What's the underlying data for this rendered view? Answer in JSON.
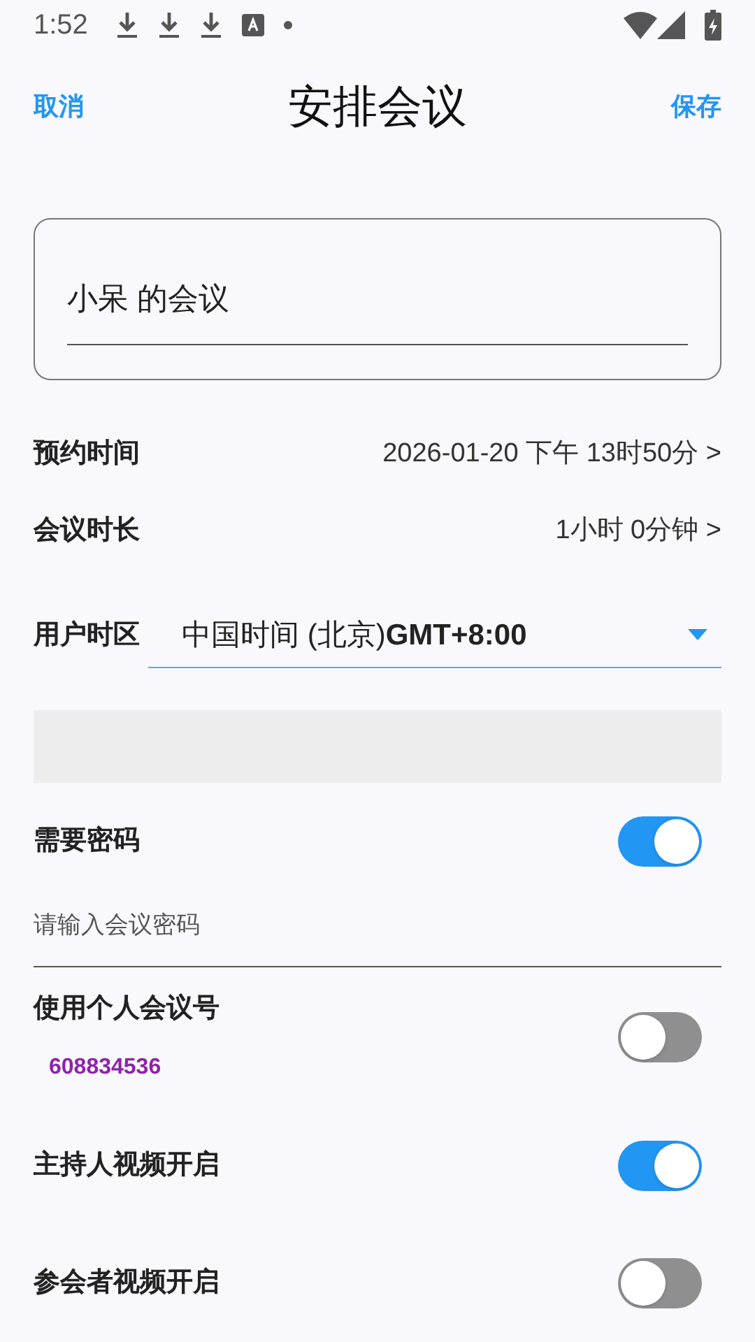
{
  "status_bar": {
    "time": "1:52"
  },
  "header": {
    "cancel": "取消",
    "title": "安排会议",
    "save": "保存"
  },
  "topic": {
    "value": "小呆 的会议"
  },
  "rows": [
    {
      "label": "预约时间",
      "value": "2026-01-20 下午 13时50分 >"
    },
    {
      "label": "会议时长",
      "value": "1小时 0分钟 >"
    }
  ],
  "timezone": {
    "label": "用户时区",
    "value": "中国时间 (北京)**GMT+8:00**"
  },
  "settings": [
    {
      "kind": "toggle",
      "label": "需要密码",
      "on": true
    },
    {
      "kind": "field",
      "placeholder": "请输入会议密码"
    },
    {
      "kind": "toggle",
      "label": "使用个人会议号",
      "on": false,
      "note": "608834536"
    },
    {
      "kind": "toggle",
      "label": "主持人视频开启",
      "on": true
    },
    {
      "kind": "toggle",
      "label": "参会者视频开启",
      "on": false
    }
  ]
}
